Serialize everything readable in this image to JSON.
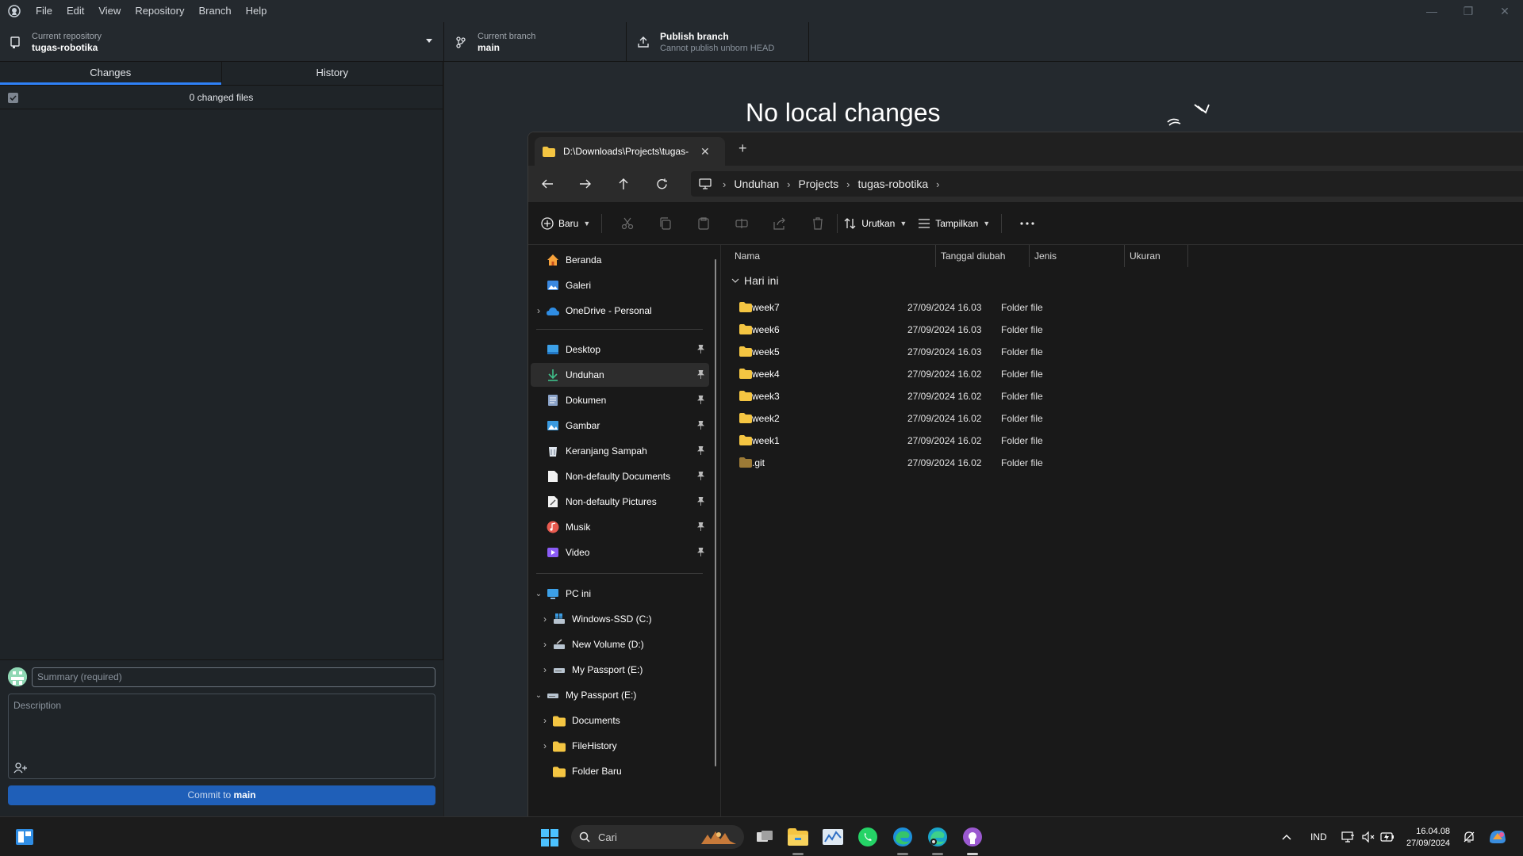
{
  "github": {
    "menu": [
      "File",
      "Edit",
      "View",
      "Repository",
      "Branch",
      "Help"
    ],
    "repo": {
      "label": "Current repository",
      "value": "tugas-robotika"
    },
    "branch": {
      "label": "Current branch",
      "value": "main"
    },
    "publish": {
      "label": "Publish branch",
      "sub": "Cannot publish unborn HEAD"
    },
    "tabs": {
      "changes": "Changes",
      "history": "History"
    },
    "changed_files": "0 changed files",
    "summary_placeholder": "Summary (required)",
    "description_placeholder": "Description",
    "commit_prefix": "Commit to ",
    "commit_branch": "main",
    "no_local_changes": "No local changes"
  },
  "explorer": {
    "tab_title": "D:\\Downloads\\Projects\\tugas-",
    "breadcrumb": [
      "Unduhan",
      "Projects",
      "tugas-robotika"
    ],
    "commands": {
      "new": "Baru",
      "sort": "Urutkan",
      "view": "Tampilkan"
    },
    "nav": {
      "home": "Beranda",
      "gallery": "Galeri",
      "onedrive": "OneDrive - Personal",
      "desktop": "Desktop",
      "downloads": "Unduhan",
      "documents": "Dokumen",
      "pictures": "Gambar",
      "recycle": "Keranjang Sampah",
      "nondoc": "Non-defaulty Documents",
      "nonpic": "Non-defaulty Pictures",
      "music": "Musik",
      "video": "Video",
      "pc": "PC ini",
      "drive_c": "Windows-SSD (C:)",
      "drive_d": "New Volume (D:)",
      "drive_e": "My Passport (E:)",
      "passport": "My Passport (E:)",
      "pp_documents": "Documents",
      "pp_filehistory": "FileHistory",
      "pp_folderbaru": "Folder Baru"
    },
    "columns": {
      "name": "Nama",
      "date": "Tanggal diubah",
      "type": "Jenis",
      "size": "Ukuran"
    },
    "group": "Hari ini",
    "files": [
      {
        "name": "week7",
        "date": "27/09/2024 16.03",
        "type": "Folder file"
      },
      {
        "name": "week6",
        "date": "27/09/2024 16.03",
        "type": "Folder file"
      },
      {
        "name": "week5",
        "date": "27/09/2024 16.03",
        "type": "Folder file"
      },
      {
        "name": "week4",
        "date": "27/09/2024 16.02",
        "type": "Folder file"
      },
      {
        "name": "week3",
        "date": "27/09/2024 16.02",
        "type": "Folder file"
      },
      {
        "name": "week2",
        "date": "27/09/2024 16.02",
        "type": "Folder file"
      },
      {
        "name": "week1",
        "date": "27/09/2024 16.02",
        "type": "Folder file"
      },
      {
        "name": ".git",
        "date": "27/09/2024 16.02",
        "type": "Folder file"
      }
    ]
  },
  "taskbar": {
    "search_placeholder": "Cari",
    "language": "IND",
    "time": "16.04.08",
    "date": "27/09/2024"
  },
  "colors": {
    "accent": "#2f81f7",
    "commit_button": "#1f5fb8",
    "folder": "#f4c542"
  }
}
